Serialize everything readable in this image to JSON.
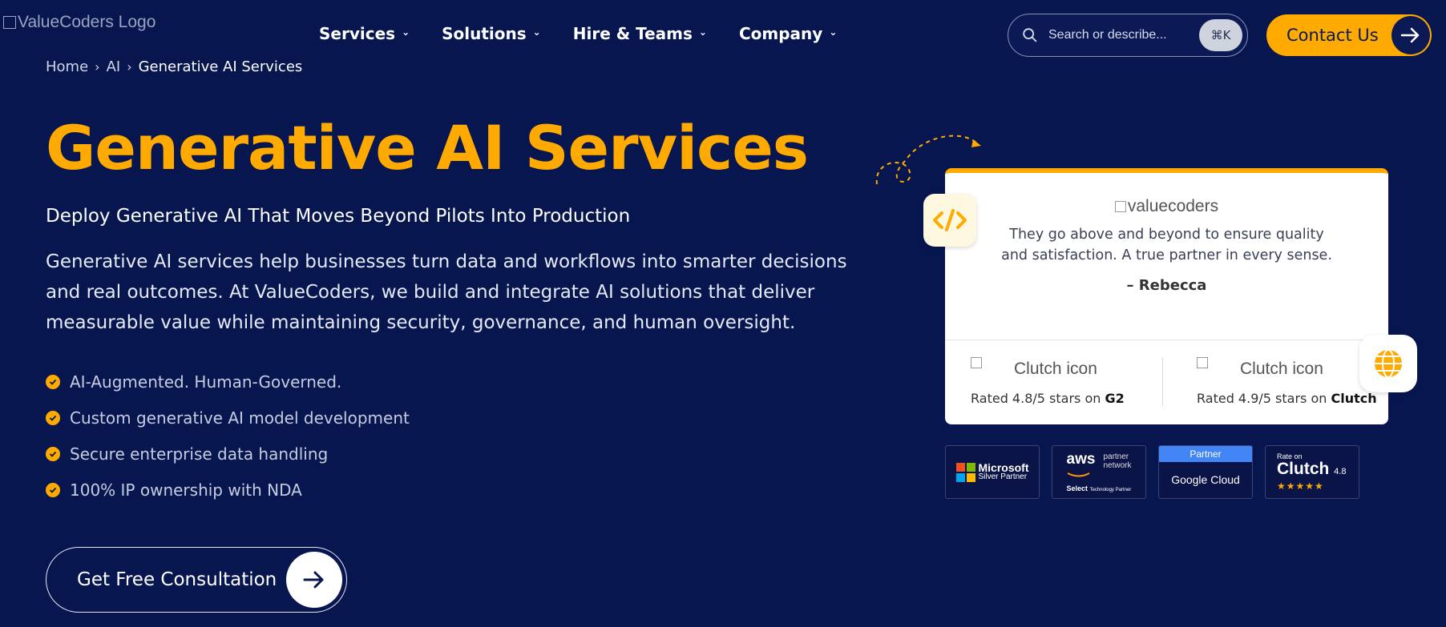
{
  "header": {
    "logo_alt": "ValueCoders Logo",
    "nav": [
      {
        "label": "Services"
      },
      {
        "label": "Solutions"
      },
      {
        "label": "Hire & Teams"
      },
      {
        "label": "Company"
      }
    ],
    "search": {
      "placeholder": "Search or describe...",
      "shortcut": "⌘K"
    },
    "contact_label": "Contact Us"
  },
  "breadcrumb": {
    "home": "Home",
    "section": "AI",
    "current": "Generative AI Services"
  },
  "hero": {
    "title": "Generative AI Services",
    "subtitle": "Deploy Generative AI That Moves Beyond Pilots Into Production",
    "description": "Generative AI services help businesses turn data and workflows into smarter decisions and real outcomes. At ValueCoders, we build and integrate AI solutions that deliver measurable value while maintaining security, governance, and human oversight.",
    "features": [
      "AI-Augmented. Human-Governed.",
      "Custom generative AI model development",
      "Secure enterprise data handling",
      "100% IP ownership with NDA"
    ],
    "cta_label": "Get Free Consultation"
  },
  "testimonial": {
    "brand_alt": "valuecoders",
    "quote": "They go above and beyond to ensure quality and satisfaction. A true partner in every sense.",
    "author": "– Rebecca",
    "ratings": [
      {
        "icon_alt": "Clutch icon",
        "text": "Rated 4.8/5 stars on ",
        "platform": "G2"
      },
      {
        "icon_alt": "Clutch icon",
        "text": "Rated 4.9/5 stars on ",
        "platform": "Clutch"
      }
    ]
  },
  "badges": {
    "microsoft": {
      "line1": "Microsoft",
      "line2": "Silver Partner"
    },
    "aws": {
      "logo": "aws",
      "line1": "partner",
      "line2": "network",
      "tier": "Select",
      "tier_sub": "Technology Partner"
    },
    "google": {
      "top": "Partner",
      "name": "Google Cloud"
    },
    "clutch": {
      "rate": "Rate on",
      "name": "Clutch",
      "score": "4.8",
      "stars": "★★★★★"
    }
  },
  "colors": {
    "background": "#081650",
    "accent": "#ffaa00",
    "card": "#ffffff"
  }
}
